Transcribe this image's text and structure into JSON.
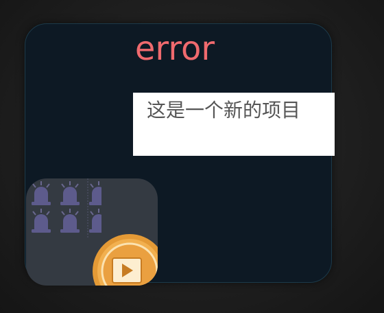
{
  "card": {
    "title": "error",
    "title_color": "#f06a6e",
    "background": "#0d1924"
  },
  "item": {
    "label": "这是一个新的项目"
  },
  "media_tile": {
    "pattern_icon": "siren-icon",
    "badge_icon": "play-badge-icon",
    "accent_color": "#e8a33c"
  }
}
